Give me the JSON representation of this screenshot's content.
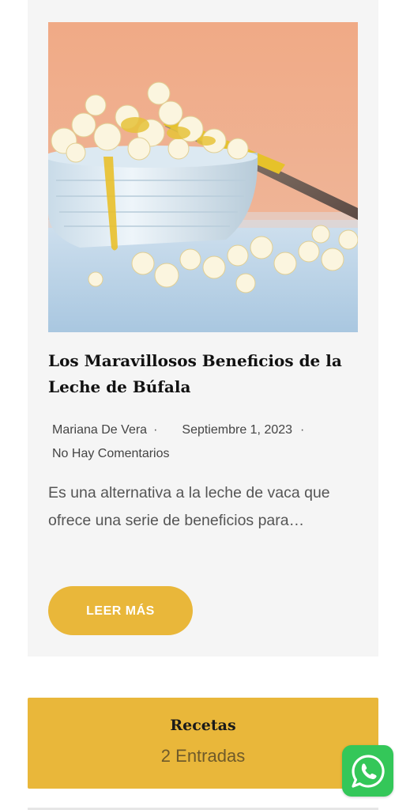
{
  "post": {
    "image_alt": "Palomitas de maíz en un tazón blanco con mantequilla",
    "title": "Los Maravillosos Beneficios de la Leche de Búfala",
    "author": "Mariana De Vera",
    "separator": "·",
    "date": "Septiembre 1, 2023",
    "comments": "No Hay Comentarios",
    "excerpt": "Es una alternativa a la leche de vaca que ofrece una serie de beneficios para…",
    "read_more_label": "LEER MÁS"
  },
  "category": {
    "title": "Recetas",
    "count": "2 Entradas"
  },
  "whatsapp": {
    "icon": "whatsapp-icon"
  },
  "colors": {
    "accent": "#e9b73a",
    "card_bg": "#f5f5f5",
    "whatsapp_green": "#34c759"
  }
}
